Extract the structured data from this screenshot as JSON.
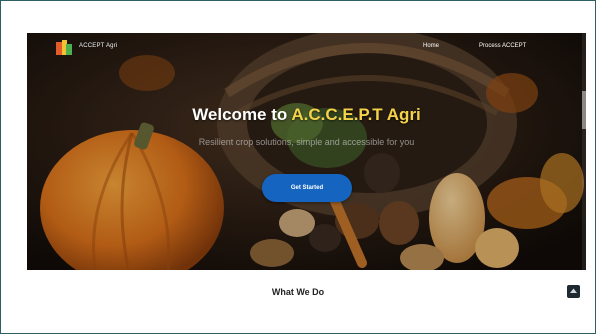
{
  "nav": {
    "brand": "ACCEPT Agri",
    "links": [
      "Home",
      "Process ACCEPT"
    ]
  },
  "hero": {
    "title_prefix": "Welcome to ",
    "title_highlight": "A.C.C.E.P.T Agri",
    "subtitle": "Resilient crop solutions, simple and accessible for you",
    "cta_label": "Get Started"
  },
  "section": {
    "title": "What We Do"
  },
  "colors": {
    "accent_yellow": "#f4d24a",
    "cta_blue": "#1565c0",
    "frame_border": "#2e5f63"
  },
  "icons": {
    "logo": "accept-logo-icon",
    "back_to_top": "arrow-up-icon"
  }
}
